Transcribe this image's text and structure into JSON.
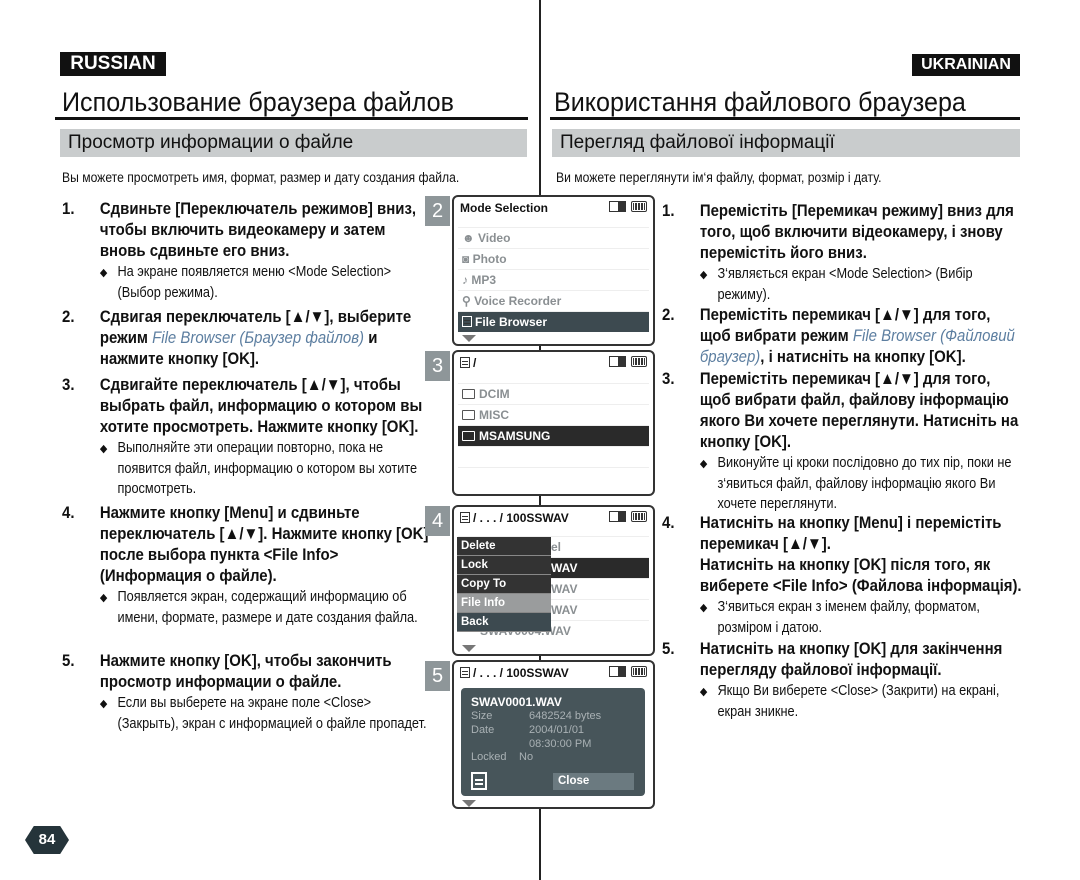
{
  "left": {
    "lang_badge": "RUSSIAN",
    "title": "Использование браузера файлов",
    "section": "Просмотр информации о файле",
    "intro": "Вы можете просмотреть имя, формат, размер и дату создания файла.",
    "steps": [
      {
        "num": "1.",
        "parts": [
          {
            "t": "Сдвиньте [Переключатель режимов] вниз, чтобы включить видеокамеру и затем вновь сдвиньте его вниз."
          }
        ],
        "bullets": [
          "На экране появляется меню <Mode Selection> (Выбор режима)."
        ]
      },
      {
        "num": "2.",
        "parts": [
          {
            "t": "Сдвигая переключатель [▲/▼], выберите режим "
          },
          {
            "t": "File Browser (Браузер файлов)",
            "em": true
          },
          {
            "t": " и нажмите кнопку [OK]."
          }
        ],
        "bullets": []
      },
      {
        "num": "3.",
        "parts": [
          {
            "t": "Сдвигайте переключатель [▲/▼], чтобы выбрать файл, информацию о котором вы хотите просмотреть. Нажмите кнопку [OK]."
          }
        ],
        "bullets": [
          "Выполняйте эти операции повторно, пока не появится файл, информацию о котором вы хотите просмотреть."
        ]
      },
      {
        "num": "4.",
        "parts": [
          {
            "t": "Нажмите кнопку [Menu] и сдвиньте переключатель [▲/▼]. Нажмите кнопку [OK] после выбора пункта <File Info> (Информация о файле)."
          }
        ],
        "bullets": [
          "Появляется экран, содержащий информацию об имени, формате, размере и дате создания файла."
        ]
      },
      {
        "num": "5.",
        "parts": [
          {
            "t": "Нажмите кнопку [OK], чтобы закончить просмотр информации о файле."
          }
        ],
        "bullets": [
          "Если вы выберете на экране поле <Close> (Закрыть), экран с информацией о файле пропадет."
        ]
      }
    ]
  },
  "right": {
    "lang_badge": "UKRAINIAN",
    "title": "Використання файлового браузера",
    "section": "Перегляд файлової інформації",
    "intro": "Ви можете переглянути ім‘я файлу, формат, розмір і дату.",
    "steps": [
      {
        "num": "1.",
        "parts": [
          {
            "t": "Перемістіть [Перемикач режиму] вниз для того, щоб включити відеокамеру, і знову перемістіть його вниз."
          }
        ],
        "bullets": [
          "З‘являється екран <Mode Selection> (Вибір режиму)."
        ]
      },
      {
        "num": "2.",
        "parts": [
          {
            "t": "Перемістіть перемикач [▲/▼] для того, щоб вибрати режим "
          },
          {
            "t": "File Browser (Файловий браузер)",
            "em": true
          },
          {
            "t": ", і натисніть на кнопку [OK]."
          }
        ],
        "bullets": []
      },
      {
        "num": "3.",
        "parts": [
          {
            "t": "Перемістіть перемикач [▲/▼] для того, щоб вибрати файл, файлову інформацію якого Ви хочете переглянути. Натисніть на кнопку [OK]."
          }
        ],
        "bullets": [
          "Виконуйте ці кроки послідовно до тих пір, поки не з‘явиться файл, файлову інформацію якого Ви хочете переглянути."
        ]
      },
      {
        "num": "4.",
        "parts": [
          {
            "t": "Натисніть на кнопку [Menu] і перемістіть перемикач [▲/▼]."
          },
          {
            "br": true
          },
          {
            "t": "Натисніть на кнопку [OK] після того, як виберете <File Info> (Файлова інформація)."
          }
        ],
        "bullets": [
          "З‘явиться екран з іменем файлу, форматом, розміром і датою."
        ]
      },
      {
        "num": "5.",
        "parts": [
          {
            "t": "Натисніть на кнопку [OK] для закінчення перегляду файлової інформації."
          }
        ],
        "bullets": [
          "Якщо Ви виберете <Close> (Закрити) на екрані, екран зникне."
        ]
      }
    ]
  },
  "screens": {
    "s2": {
      "num": "2",
      "header": "Mode Selection",
      "items": [
        {
          "icon": "video-camera-icon",
          "label": "Video"
        },
        {
          "icon": "camera-icon",
          "label": "Photo"
        },
        {
          "icon": "music-note-icon",
          "label": "MP3"
        },
        {
          "icon": "microphone-icon",
          "label": "Voice Recorder"
        },
        {
          "icon": "document-icon",
          "label": "File Browser",
          "selected": true
        }
      ]
    },
    "s3": {
      "num": "3",
      "header": "/",
      "items": [
        {
          "label": "DCIM"
        },
        {
          "label": "MISC"
        },
        {
          "label": "MSAMSUNG",
          "selected": true
        }
      ]
    },
    "s4": {
      "num": "4",
      "header": "/ . . . / 100SSWAV",
      "behind": [
        "el",
        "WAV",
        "WAV",
        "WAV",
        "SWAV0004.WAV"
      ],
      "menu": [
        "Delete",
        "Lock",
        "Copy To",
        "File Info",
        "Back"
      ],
      "menu_highlighted": "File Info"
    },
    "s5": {
      "num": "5",
      "header": "/ . . . / 100SSWAV",
      "info": {
        "filename": "SWAV0001.WAV",
        "size_label": "Size",
        "size": "6482524 bytes",
        "date_label": "Date",
        "date": "2004/01/01",
        "time": "08:30:00 PM",
        "locked_label": "Locked",
        "locked": "No",
        "close": "Close"
      }
    }
  },
  "page_number": "84",
  "colors": {
    "accent_italic": "#5c7ea0",
    "selected_row": "#3d4a50",
    "section_bg": "#c9cccd",
    "step_badge": "#8e9699"
  }
}
